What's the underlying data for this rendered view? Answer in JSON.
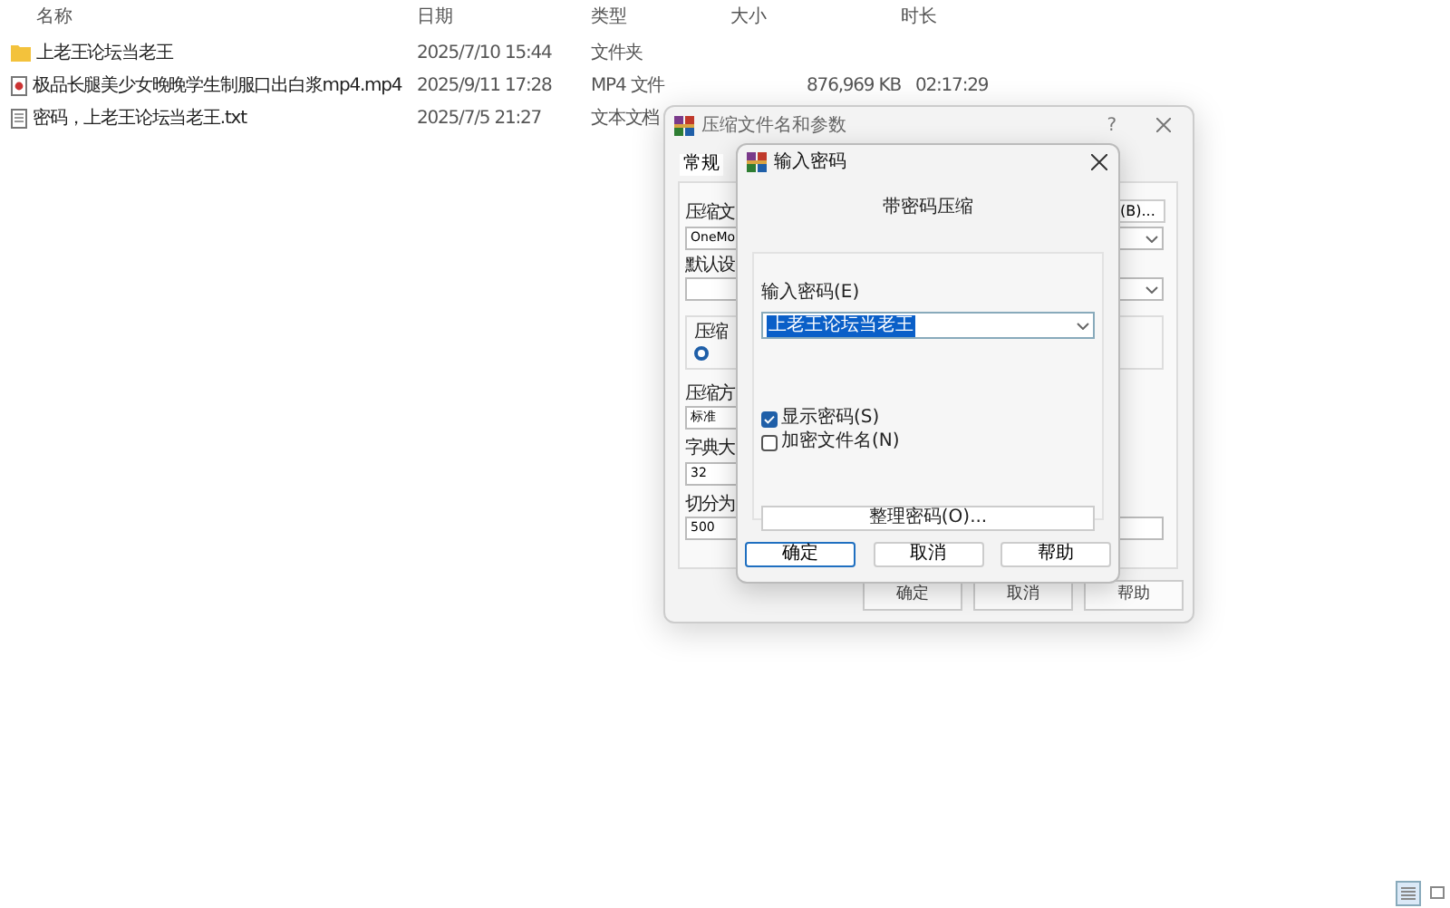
{
  "explorer": {
    "columns": [
      "名称",
      "日期",
      "类型",
      "大小",
      "时长"
    ],
    "rows": [
      {
        "kind": "folder",
        "name": "上老王论坛当老王",
        "date": "2025/7/10 15:44",
        "type": "文件夹"
      },
      {
        "kind": "video",
        "name": "极品长腿美少女晚晚学生制服口出白浆mp4.mp4",
        "date": "2025/9/11 17:28",
        "type": "MP4 文件",
        "size": "876,969 KB",
        "duration": "02:17:29"
      },
      {
        "kind": "text",
        "name": "密码，上老王论坛当老王.txt",
        "date": "2025/7/5 21:27",
        "type": "文本文档"
      }
    ]
  },
  "back_dialog": {
    "title": "压缩文件名和参数",
    "help": "?",
    "tab": {
      "label": "常规",
      "selected": true
    },
    "archive_label": "压缩文",
    "format_option": {
      "selected": true
    },
    "browse_button": "(B)...",
    "archive_value": "OneMo",
    "profile_label": "默认设",
    "format_label": "压缩",
    "method_label": "压缩方",
    "method_value": "标准",
    "dict_label": "字典大",
    "dict_value": "32",
    "split_label": "切分为",
    "split_value": "500",
    "buttons": [
      "确定",
      "取消",
      "帮助"
    ]
  },
  "front_dialog": {
    "title": "输入密码",
    "heading": "带密码压缩",
    "password_label": "输入密码(E)",
    "password_value": "上老王论坛当老王",
    "options": [
      {
        "label": "显示密码(S)",
        "checked": true
      },
      {
        "label": "加密文件名(N)",
        "checked": false
      }
    ],
    "manage_button": "整理密码(O)...",
    "buttons": [
      {
        "label": "确定",
        "default": true
      },
      {
        "label": "取消",
        "default": false
      },
      {
        "label": "帮助",
        "default": false
      }
    ]
  },
  "view_buttons": [
    {
      "kind": "details",
      "selected": true
    },
    {
      "kind": "tiles",
      "selected": false
    }
  ]
}
